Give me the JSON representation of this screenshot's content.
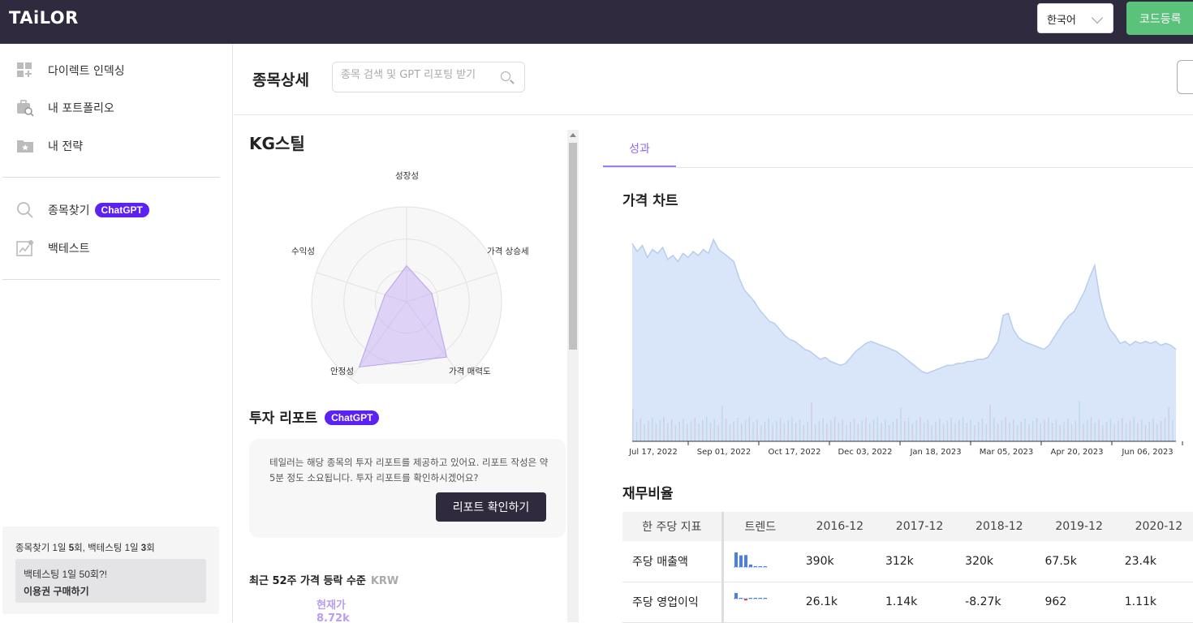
{
  "app": {
    "logo": "TAiLOR"
  },
  "topbar": {
    "language": "한국어",
    "code_button": "코드등록"
  },
  "sidebar": {
    "items": [
      {
        "label": "다이렉트 인덱싱",
        "icon": "grid-plus-icon"
      },
      {
        "label": "내 포트폴리오",
        "icon": "briefcase-search-icon"
      },
      {
        "label": "내 전략",
        "icon": "folder-star-icon"
      },
      {
        "label": "종목찾기",
        "icon": "search-icon",
        "badge": "ChatGPT"
      },
      {
        "label": "백테스트",
        "icon": "chart-icon"
      }
    ],
    "quota": {
      "line_prefix": "종목찾기 1일 ",
      "find_count": "5",
      "line_mid": "회, 백테스팅 1일 ",
      "backtest_count": "3",
      "line_suffix": "회",
      "promo_text": "백테스팅 1일 50회?!",
      "promo_link": "이용권 구매하기"
    }
  },
  "header": {
    "title": "종목상세",
    "search_placeholder": "종목 검색 및 GPT 리포팅 받기"
  },
  "stock": {
    "name": "KG스틸",
    "radar": {
      "axes": [
        "성장성",
        "가격 상승세",
        "가격 매력도",
        "안정성",
        "수익성"
      ],
      "values": [
        0.38,
        0.28,
        0.72,
        0.85,
        0.24
      ]
    }
  },
  "report": {
    "title": "투자 리포트",
    "badge": "ChatGPT",
    "description": "테일러는 해당 종목의 투자 리포트를 제공하고 있어요. 리포트 작성은 약 5분 정도 소요됩니다. 투자 리포트를 확인하시겠어요?",
    "button": "리포트 확인하기"
  },
  "range52": {
    "title": "최근 52주 가격 등락 수준",
    "unit": "KRW",
    "current_label": "현재가",
    "current_value": "8.72k"
  },
  "tabs": [
    {
      "label": "성과",
      "active": true
    }
  ],
  "price_chart": {
    "title": "가격 차트"
  },
  "chart_data": {
    "type": "area",
    "x_ticks": [
      "Jul 17, 2022",
      "Sep 01, 2022",
      "Oct 17, 2022",
      "Dec 03, 2022",
      "Jan 18, 2023",
      "Mar 05, 2023",
      "Apr 20, 2023",
      "Jun 06, 2023"
    ],
    "values": [
      9.9,
      9.5,
      9.8,
      9.2,
      9.6,
      9.4,
      9.7,
      9.1,
      9.3,
      9.0,
      9.4,
      9.2,
      9.5,
      9.3,
      9.6,
      9.4,
      10.1,
      9.6,
      9.4,
      9.2,
      9.0,
      8.2,
      7.6,
      7.3,
      7.0,
      6.6,
      6.3,
      6.0,
      5.9,
      5.6,
      5.3,
      5.1,
      5.0,
      4.8,
      4.6,
      4.5,
      4.3,
      4.1,
      4.2,
      4.0,
      3.9,
      3.8,
      3.9,
      4.2,
      4.5,
      4.7,
      4.9,
      5.0,
      4.9,
      4.8,
      4.7,
      4.6,
      4.5,
      4.3,
      4.1,
      3.9,
      3.7,
      3.5,
      3.4,
      3.5,
      3.6,
      3.7,
      3.8,
      3.8,
      3.9,
      3.9,
      4.0,
      4.0,
      4.1,
      4.1,
      4.2,
      4.6,
      5.0,
      6.3,
      6.4,
      5.6,
      5.2,
      5.0,
      4.9,
      4.8,
      4.7,
      4.6,
      4.8,
      5.2,
      5.6,
      6.0,
      6.3,
      6.5,
      7.0,
      7.5,
      8.2,
      8.8,
      7.2,
      6.2,
      5.6,
      5.3,
      4.9,
      5.0,
      4.8,
      5.0,
      4.9,
      5.0,
      4.9,
      5.0,
      4.8,
      4.9,
      4.8,
      4.6
    ],
    "y_range": [
      0,
      11
    ]
  },
  "financial_ratios": {
    "title": "재무비율",
    "headers": [
      "한 주당 지표",
      "트렌드",
      "2016-12",
      "2017-12",
      "2018-12",
      "2019-12",
      "2020-12"
    ],
    "rows": [
      {
        "label": "주당 매출액",
        "trend": [
          390,
          312,
          320,
          67.5,
          23.4,
          20,
          18
        ],
        "values": [
          "390k",
          "312k",
          "320k",
          "67.5k",
          "23.4k"
        ]
      },
      {
        "label": "주당 영업이익",
        "trend": [
          26.1,
          1.14,
          -8.27,
          0.962,
          1.11,
          0.9,
          1.0
        ],
        "values": [
          "26.1k",
          "1.14k",
          "-8.27k",
          "962",
          "1.11k"
        ]
      }
    ]
  },
  "colors": {
    "topbar": "#2f2a3e",
    "accent": "#8e6cf0",
    "badge": "#5b21f5",
    "code_button": "#5ac27a",
    "chart_fill": "#dbe6f8",
    "chart_line": "#b7cdee"
  }
}
